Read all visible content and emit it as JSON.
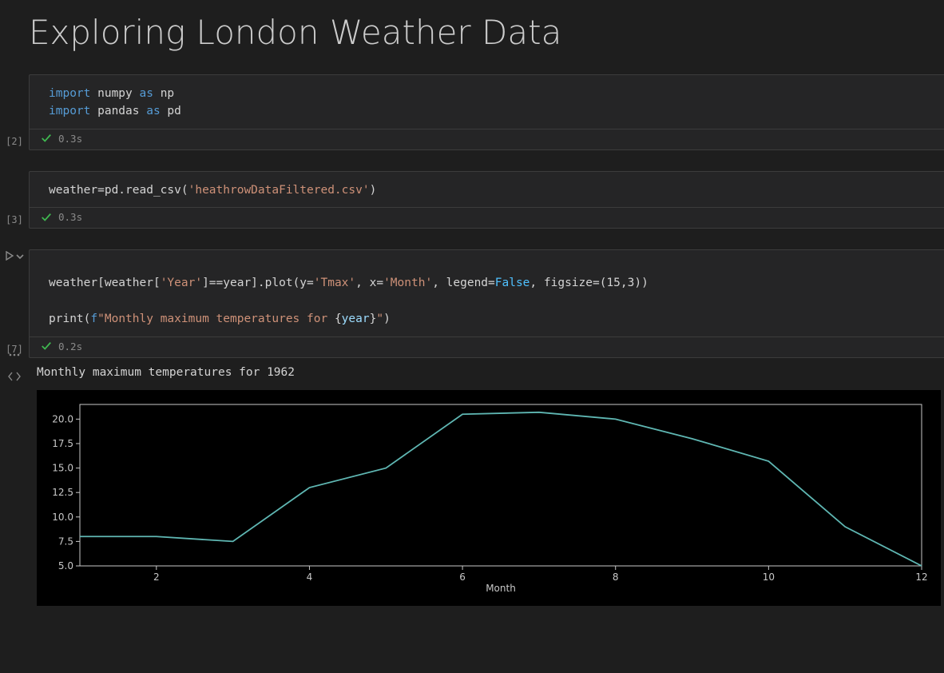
{
  "title": "Exploring London Weather Data",
  "cells": [
    {
      "exec_label": "[2]",
      "code_html": "<span class='kw'>import</span> numpy <span class='kw'>as</span> np\n<span class='kw'>import</span> pandas <span class='kw'>as</span> pd",
      "time": "0.3s"
    },
    {
      "exec_label": "[3]",
      "code_html": "weather=pd.read_csv(<span class='str'>'heathrowDataFiltered.csv'</span>)",
      "time": "0.3s"
    },
    {
      "exec_label": "[7]",
      "code_html": "weather[weather[<span class='str'>'Year'</span>]==year].plot(y=<span class='str'>'Tmax'</span>, x=<span class='str'>'Month'</span>, legend=<span class='const'>False</span>, figsize=(15,3))\n\nprint(<span class='fpre'>f</span><span class='str'>\"Monthly maximum temperatures for </span>{<span class='cur'>year</span>}<span class='str'>\"</span>)",
      "time": "0.2s",
      "show_run": true
    }
  ],
  "output_text": "Monthly maximum temperatures for 1962",
  "chart_data": {
    "type": "line",
    "xlabel": "Month",
    "ylabel": "",
    "x": [
      1,
      2,
      3,
      4,
      5,
      6,
      7,
      8,
      9,
      10,
      11,
      12
    ],
    "values": [
      8.0,
      8.0,
      7.5,
      13.0,
      15.0,
      20.5,
      20.7,
      20.0,
      18.0,
      15.7,
      9.0,
      5.0
    ],
    "yticks": [
      5.0,
      7.5,
      10.0,
      12.5,
      15.0,
      17.5,
      20.0
    ],
    "xticks": [
      2,
      4,
      6,
      8,
      10,
      12
    ],
    "xlim": [
      1,
      12
    ],
    "ylim": [
      5.0,
      21.5
    ]
  }
}
